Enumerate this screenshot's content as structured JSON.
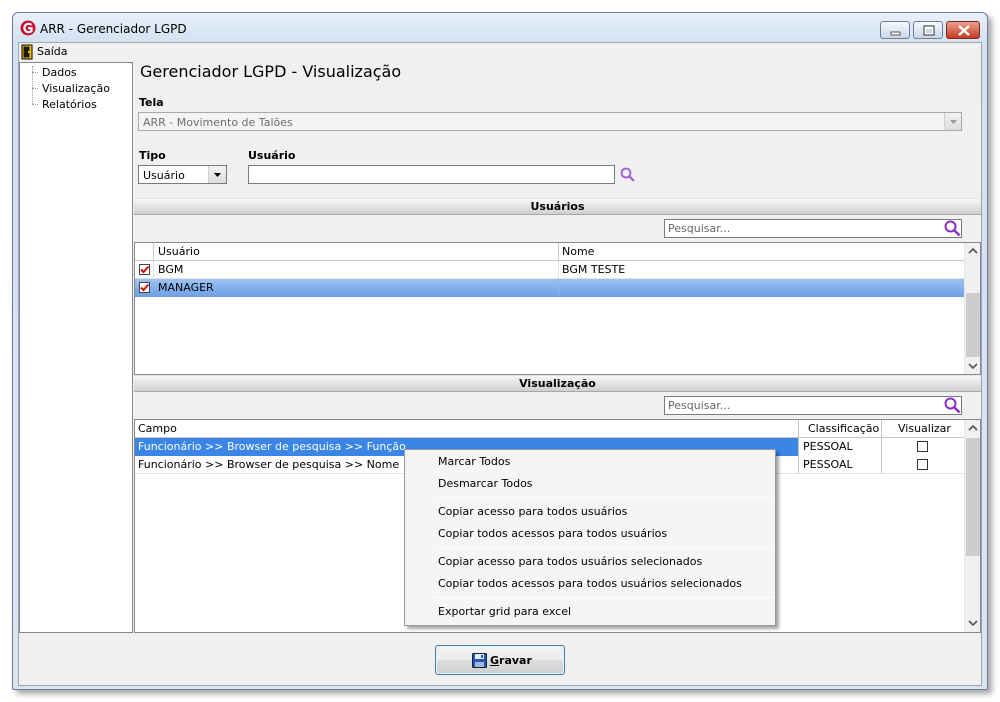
{
  "window": {
    "title": "ARR - Gerenciador LGPD",
    "menu_exit": "Saída"
  },
  "colors": {
    "accent_red": "#c8102e",
    "selection_blue": "#3b85e6",
    "search_purple": "#8b2cc9"
  },
  "tree": {
    "items": [
      "Dados",
      "Visualização",
      "Relatórios"
    ]
  },
  "page_title": "Gerenciador LGPD - Visualização",
  "tela": {
    "label": "Tela",
    "value": "ARR - Movimento de Talões"
  },
  "tipo": {
    "label": "Tipo",
    "value": "Usuário"
  },
  "usuario": {
    "label": "Usuário",
    "value": ""
  },
  "usuarios_section": {
    "title": "Usuários",
    "search_placeholder": "Pesquisar...",
    "columns": [
      "Usuário",
      "Nome"
    ],
    "rows": [
      {
        "usuario": "BGM",
        "nome": "BGM TESTE",
        "checked": true
      },
      {
        "usuario": "MANAGER",
        "nome": "",
        "checked": true
      }
    ]
  },
  "visualizacao_section": {
    "title": "Visualização",
    "search_placeholder": "Pesquisar...",
    "columns": [
      "Campo",
      "Classificação",
      "Visualizar"
    ],
    "rows": [
      {
        "campo": "Funcionário >> Browser de pesquisa >> Função",
        "classificacao": "PESSOAL",
        "visualizar": false
      },
      {
        "campo": "Funcionário >> Browser de pesquisa >> Nome",
        "classificacao": "PESSOAL",
        "visualizar": false
      }
    ]
  },
  "context_menu": {
    "items": [
      "Marcar Todos",
      "Desmarcar Todos",
      "Copiar acesso para todos usuários",
      "Copiar todos acessos para todos usuários",
      "Copiar acesso para todos usuários selecionados",
      "Copiar todos acessos para todos usuários selecionados",
      "Exportar grid para excel"
    ]
  },
  "gravar": {
    "label": "Gravar"
  }
}
